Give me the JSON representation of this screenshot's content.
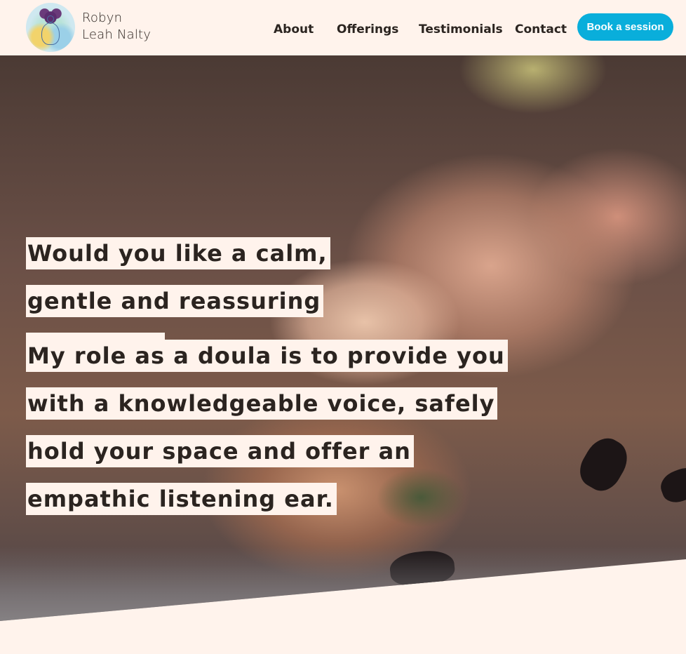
{
  "header": {
    "brand_line1": "Robyn",
    "brand_line2": "Leah Nalty",
    "logo_icon": "meditation-tree-logo"
  },
  "nav": {
    "items": [
      {
        "label": "About"
      },
      {
        "label": "Offerings"
      },
      {
        "label": "Testimonials"
      },
      {
        "label": "Contact"
      }
    ],
    "cta_label": "Book a session"
  },
  "hero": {
    "question": "Would you like a calm, gentle and reassuring presence?",
    "message": "My role as a doula is to provide you with a knowledgeable voice, safely hold your space and offer an empathic listening ear."
  },
  "colors": {
    "background": "#fff3ec",
    "accent": "#09aedb",
    "text": "#2b2420"
  }
}
